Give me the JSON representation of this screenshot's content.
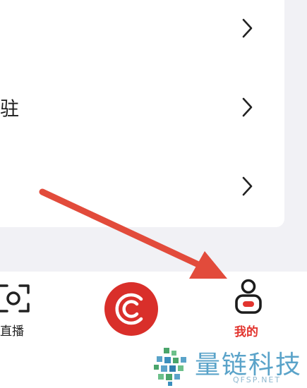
{
  "menu": {
    "rows": [
      {
        "label": ""
      },
      {
        "label": "驻"
      },
      {
        "label": ""
      }
    ]
  },
  "tabbar": {
    "live_label": "直播",
    "mine_label": "我的"
  },
  "colors": {
    "accent": "#e2342e",
    "center_button": "#d92f2a",
    "arrow": "#e24b3b",
    "watermark": "#5aa3c9"
  },
  "icons": {
    "row_chevron": "chevron-right-icon",
    "live": "live-camera-icon",
    "center": "center-c-logo-icon",
    "mine": "person-icon"
  },
  "watermark": {
    "title": "量链科技",
    "subtitle": "QFSP.NET"
  }
}
